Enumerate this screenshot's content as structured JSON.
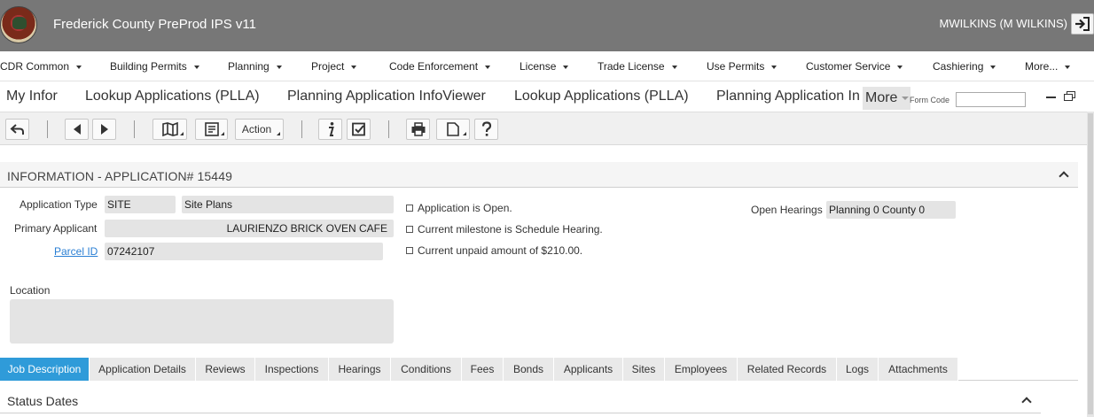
{
  "header": {
    "app_title": "Frederick County PreProd IPS v11",
    "user": "MWILKINS (M WILKINS)"
  },
  "menu": [
    {
      "label": "CDR Common"
    },
    {
      "label": "Building Permits"
    },
    {
      "label": "Planning"
    },
    {
      "label": "Project"
    },
    {
      "label": "Code Enforcement"
    },
    {
      "label": "License"
    },
    {
      "label": "Trade License"
    },
    {
      "label": "Use Permits"
    },
    {
      "label": "Customer Service"
    },
    {
      "label": "Cashiering"
    },
    {
      "label": "More..."
    }
  ],
  "tabs": {
    "items": [
      {
        "label": "My Infor"
      },
      {
        "label": "Lookup Applications (PLLA)"
      },
      {
        "label": "Planning Application InfoViewer"
      },
      {
        "label": "Lookup Applications (PLLA)"
      },
      {
        "label": "Planning Application In"
      }
    ],
    "more_label": "More",
    "form_code_label": "Form Code",
    "form_code_value": ""
  },
  "toolbar": {
    "action_label": "Action"
  },
  "section": {
    "title": "INFORMATION - APPLICATION# 15449"
  },
  "fields": {
    "application_type_label": "Application Type",
    "application_type_code": "SITE",
    "application_type_desc": "Site Plans",
    "primary_applicant_label": "Primary Applicant",
    "primary_applicant_value": "LAURIENZO BRICK OVEN CAFE",
    "parcel_id_label": "Parcel ID",
    "parcel_id_value": "07242107",
    "location_label": "Location",
    "location_value": "",
    "open_hearings_label": "Open Hearings",
    "open_hearings_value": "Planning 0 County 0"
  },
  "status_lines": [
    "Application is Open.",
    "Current milestone is Schedule Hearing.",
    "Current unpaid amount of $210.00."
  ],
  "bottom_tabs": [
    {
      "label": "Job Description",
      "active": true
    },
    {
      "label": "Application Details"
    },
    {
      "label": "Reviews"
    },
    {
      "label": "Inspections"
    },
    {
      "label": "Hearings"
    },
    {
      "label": "Conditions"
    },
    {
      "label": "Fees"
    },
    {
      "label": "Bonds"
    },
    {
      "label": "Applicants"
    },
    {
      "label": "Sites"
    },
    {
      "label": "Employees"
    },
    {
      "label": "Related Records"
    },
    {
      "label": "Logs"
    },
    {
      "label": "Attachments"
    }
  ],
  "status_dates": {
    "title": "Status Dates"
  },
  "colors": {
    "header_bg": "#777777",
    "active_tab": "#2f9bd9",
    "link": "#2a7fd4"
  }
}
